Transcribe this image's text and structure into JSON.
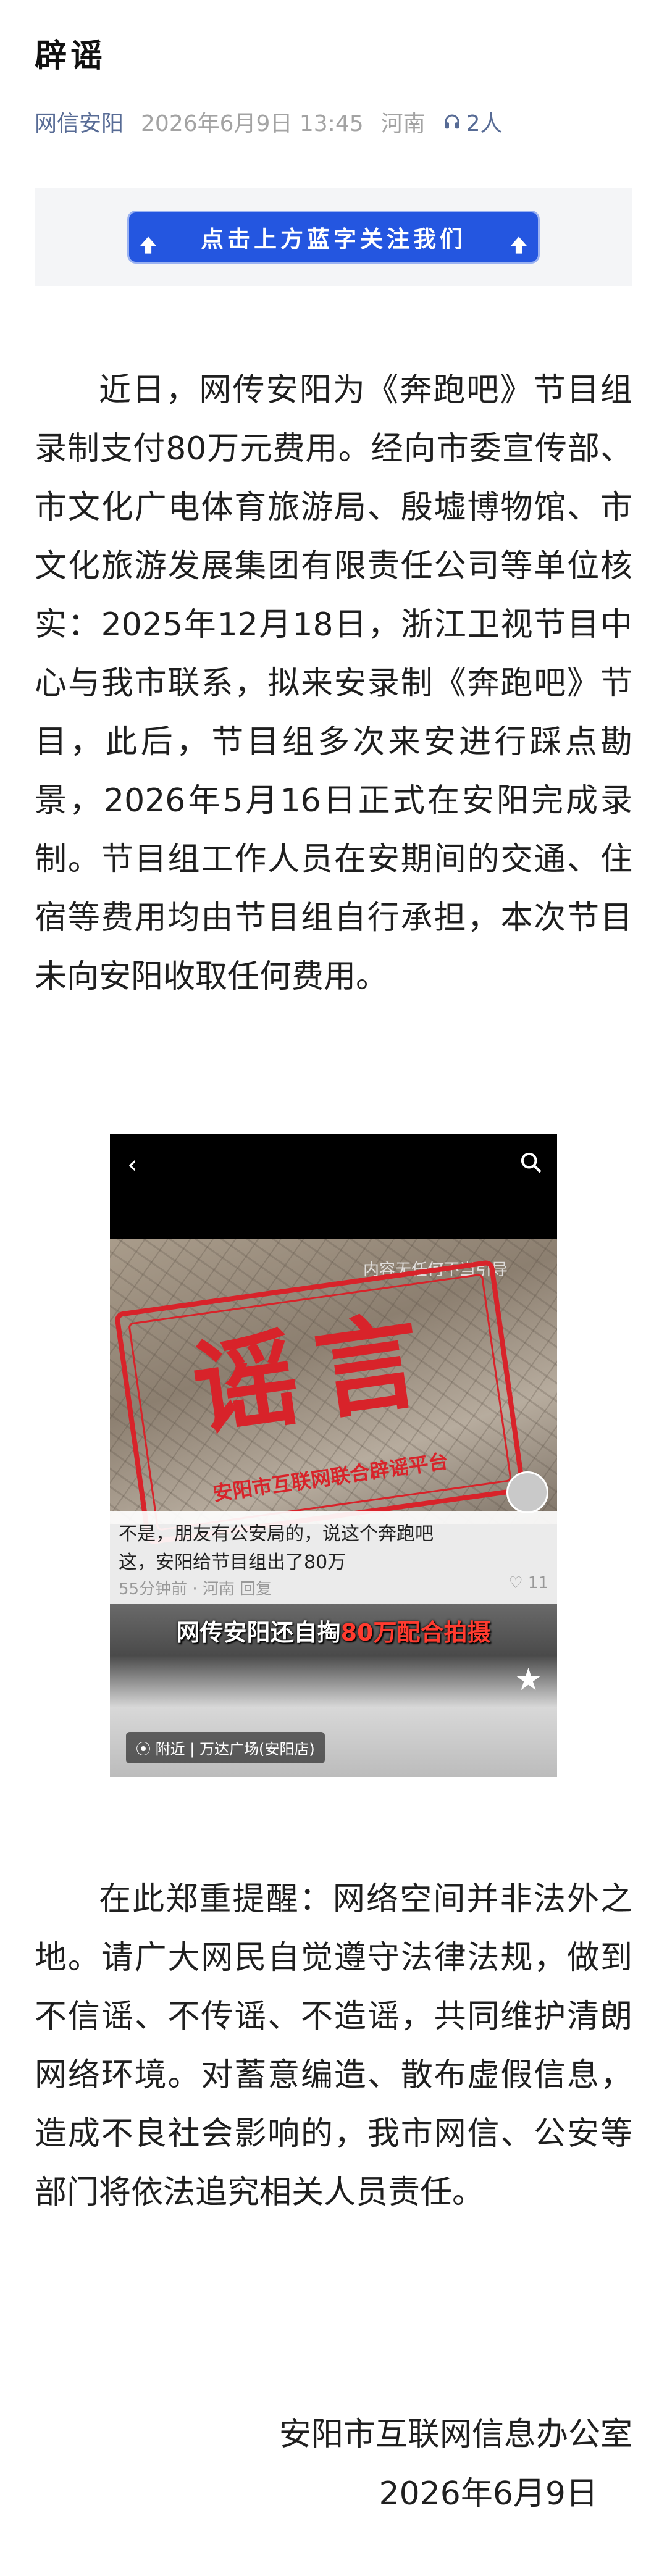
{
  "article": {
    "title": "辟谣",
    "account": "网信安阳",
    "date": "2026年6月9日 13:45",
    "location": "河南",
    "listeners": "2人"
  },
  "banner": {
    "text": "点击上方蓝字关注我们"
  },
  "body": {
    "paragraph1": "近日，网传安阳为《奔跑吧》节目组录制支付80万元费用。经向市委宣传部、市文化广电体育旅游局、殷墟博物馆、市文化旅游发展集团有限责任公司等单位核实：2025年12月18日，浙江卫视节目中心与我市联系，拟来安录制《奔跑吧》节目，此后，节目组多次来安进行踩点勘景，2026年5月16日正式在安阳完成录制。节目组工作人员在安期间的交通、住宿等费用均由节目组自行承担，本次节目未向安阳收取任何费用。",
    "paragraph2": "在此郑重提醒：网络空间并非法外之地。请广大网民自觉遵守法律法规，做到不信谣、不传谣、不造谣，共同维护清朗网络环境。对蓄意编造、散布虚假信息，造成不良社会影响的，我市网信、公安等部门将依法追究相关人员责任。"
  },
  "screenshot": {
    "back": "‹",
    "caption": "内容无任何不当引导",
    "stamp_big": "谣言",
    "stamp_small": "安阳市互联网联合辟谣平台",
    "comment_line1": "不是，朋友有公安局的，说这个奔跑吧",
    "comment_line2": "这，安阳给节目组出了80万",
    "comment_meta": "55分钟前 · 河南    回复",
    "like_count": "11",
    "headline_prefix": "网传安阳还自掏",
    "headline_em": "80万配合拍摄",
    "location_tag": "附近 | 万达广场(安阳店)"
  },
  "signature": {
    "organization": "安阳市互联网信息办公室",
    "date": "2026年6月9日"
  }
}
